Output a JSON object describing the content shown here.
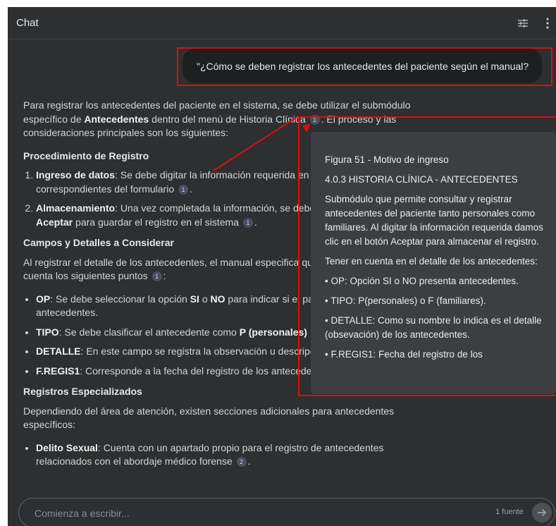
{
  "header": {
    "title": "Chat"
  },
  "user_message": "\"¿Cómo se deben registrar los antecedentes del paciente según el manual?",
  "answer": {
    "intro_pre": "Para registrar los antecedentes del paciente en el sistema, se debe utilizar el submódulo específico de ",
    "intro_bold": "Antecedentes",
    "intro_mid": " dentro del menú de Historia Clínica ",
    "intro_post": ". El proceso y las consideraciones principales son los siguientes:",
    "section1_title": "Procedimiento de Registro",
    "steps": [
      {
        "bold": "Ingreso de datos",
        "text": ": Se debe digitar la información requerida en los campos correspondientes del formulario "
      },
      {
        "bold": "Almacenamiento",
        "text": ": Una vez completada la información, se debe dar clic en el botón ",
        "bold2": "Aceptar",
        "text2": " para guardar el registro en el sistema "
      }
    ],
    "section2_title": "Campos y Detalles a Considerar",
    "section2_intro": "Al registrar el detalle de los antecedentes, el manual especifica que se deben tener en cuenta los siguientes puntos ",
    "bullets": [
      {
        "bold": "OP",
        "t1": ": Se debe seleccionar la opción ",
        "b2": "SI",
        "t2": " o ",
        "b3": "NO",
        "t3": " para indicar si el paciente presenta antecedentes."
      },
      {
        "bold": "TIPO",
        "t1": ": Se debe clasificar el antecedente como ",
        "b2": "P (personales)",
        "t2": ""
      },
      {
        "bold": "DETALLE",
        "t1": ": En este campo se registra la observación u descripción del antecedente."
      },
      {
        "bold": "F.REGIS1",
        "t1": ": Corresponde a la fecha del registro de los antecedentes."
      }
    ],
    "section3_title": "Registros Especializados",
    "section3_intro": "Dependiendo del área de atención, existen secciones adicionales para antecedentes específicos:",
    "bullets2": [
      {
        "bold": "Delito Sexual",
        "t1": ": Cuenta con un apartado propio para el registro de antecedentes relacionados con el abordaje médico forense "
      }
    ],
    "cite1": "1",
    "cite2": "2"
  },
  "popup": {
    "lines": [
      "Figura 51 - Motivo de ingreso",
      "4.0.3 HISTORIA CLÍNICA - ANTECEDENTES",
      "Submódulo que permite consultar y registrar antecedentes del paciente tanto personales como familiares. Al digitar la información requerida damos clic en el botón Aceptar para almacenar el registro.",
      "Tener en cuenta en el detalle de los antecedentes:",
      "• OP: Opción SI o NO presenta antecedentes.",
      "• TIPO: P(personales) o F (familiares).",
      "• DETALLE: Como su nombre lo indica es el detalle (obsevación) de los antecedentes.",
      "• F.REGIS1: Fecha del registro de los"
    ]
  },
  "input": {
    "placeholder": "Comienza a escribir...",
    "sources_label": "1 fuente"
  },
  "icons": {
    "tune": "tune-icon",
    "menu": "more-vert-icon",
    "send": "arrow-right-icon"
  },
  "colors": {
    "annotation": "#e00d0d",
    "background": "#2d2f31"
  }
}
